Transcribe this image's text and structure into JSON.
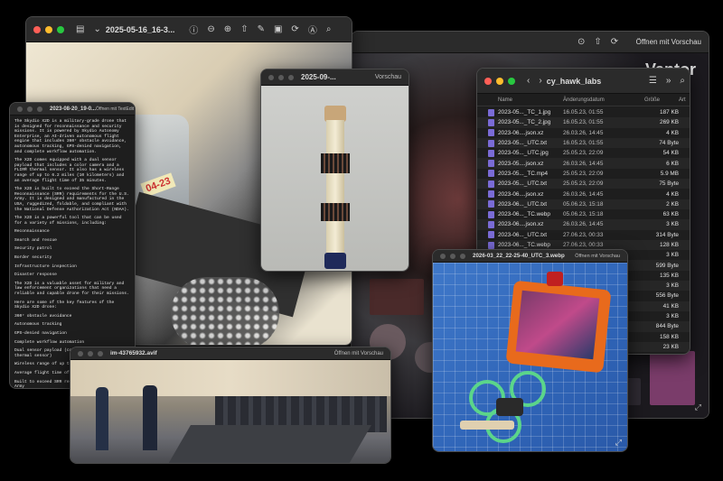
{
  "preview_back": {
    "title": "",
    "open_with": "Öffnen mit Vorschau",
    "brand": "Vantor"
  },
  "preview_foam": {
    "title": "2025-05-16_16-3...",
    "label_on_jar": "04-23"
  },
  "preview_stick": {
    "title": "2025-09-...",
    "app": "Vorschau"
  },
  "textedit": {
    "title": "2023-08-20_19-0...",
    "open_with": "Öffnen mit TextEdit",
    "paragraphs": [
      "The Skydio X2D is a military-grade drone that is designed for reconnaissance and security missions. It is powered by Skydio Autonomy Enterprise, an AI-driven autonomous flight engine that includes 360° obstacle avoidance, autonomous tracking, GPS-denied navigation, and complete workflow automation.",
      "The X2D comes equipped with a dual sensor payload that includes a color camera and a FLIR® thermal sensor. It also has a wireless range of up to 6.2 miles (10 kilometers) and an average flight time of 35 minutes.",
      "The X2D is built to exceed the Short-Range Reconnaissance (SRR) requirements for the U.S. Army. It is designed and manufactured in the USA, ruggedized, foldable, and compliant with the National Defense Authorization Act (NDAA).",
      "The X2D is a powerful tool that can be used for a variety of missions, including:",
      "Reconnaissance",
      "Search and rescue",
      "Security patrol",
      "Border security",
      "Infrastructure inspection",
      "Disaster response",
      "The X2D is a valuable asset for military and law enforcement organizations that need a reliable and capable drone for their missions.",
      "Here are some of the key features of the Skydio X2D drone:",
      "360° obstacle avoidance",
      "Autonomous tracking",
      "GPS-denied navigation",
      "Complete workflow automation",
      "Dual sensor payload (color camera + FLIR thermal sensor)",
      "Wireless range of up to 6.2 miles",
      "Average flight time of 35 minutes",
      "Built to exceed SRR requirements for the U.S. Army",
      "Ruggedized, foldable, and NDAA compliant"
    ]
  },
  "finder": {
    "title": "cy_hawk_labs",
    "columns": {
      "name": "Name",
      "date": "Änderungsdatum",
      "size": "Größe",
      "kind": "Art"
    },
    "rows": [
      {
        "name": "2023-05..._TC_1.jpg",
        "date": "16.05.23, 01:55",
        "size": "187 KB"
      },
      {
        "name": "2023-05..._TC_2.jpg",
        "date": "16.05.23, 01:55",
        "size": "269 KB"
      },
      {
        "name": "2023-06....json.xz",
        "date": "26.03.26, 14:45",
        "size": "4 KB"
      },
      {
        "name": "2023-05..._UTC.txt",
        "date": "16.05.23, 01:55",
        "size": "74 Byte"
      },
      {
        "name": "2023-05..._UTC.jpg",
        "date": "25.05.23, 22:09",
        "size": "54 KB"
      },
      {
        "name": "2023-05....json.xz",
        "date": "26.03.26, 14:45",
        "size": "6 KB"
      },
      {
        "name": "2023-05..._TC.mp4",
        "date": "25.05.23, 22:09",
        "size": "5.9 MB"
      },
      {
        "name": "2023-05..._UTC.txt",
        "date": "25.05.23, 22:09",
        "size": "75 Byte"
      },
      {
        "name": "2023-06....json.xz",
        "date": "26.03.26, 14:45",
        "size": "4 KB"
      },
      {
        "name": "2023-06..._UTC.txt",
        "date": "05.06.23, 15:18",
        "size": "2 KB"
      },
      {
        "name": "2023-06..._TC.webp",
        "date": "05.06.23, 15:18",
        "size": "63 KB"
      },
      {
        "name": "2023-06....json.xz",
        "date": "26.03.26, 14:45",
        "size": "3 KB"
      },
      {
        "name": "2023-06..._UTC.txt",
        "date": "27.06.23, 00:33",
        "size": "314 Byte"
      },
      {
        "name": "2023-06..._TC.webp",
        "date": "27.06.23, 00:33",
        "size": "128 KB"
      },
      {
        "name": "2023-06....json.xz",
        "date": "26.03.26, 14:45",
        "size": "3 KB"
      },
      {
        "name": "2023-06..._UTC.txt",
        "date": "",
        "size": "599 Byte"
      },
      {
        "name": "",
        "date": "",
        "size": "135 KB"
      },
      {
        "name": "",
        "date": "",
        "size": "3 KB"
      },
      {
        "name": "",
        "date": "",
        "size": "556 Byte"
      },
      {
        "name": "",
        "date": "",
        "size": "41 KB"
      },
      {
        "name": "",
        "date": "",
        "size": "3 KB"
      },
      {
        "name": "",
        "date": "",
        "size": "844 Byte"
      },
      {
        "name": "",
        "date": "",
        "size": "158 KB"
      },
      {
        "name": "",
        "date": "",
        "size": "23 KB"
      },
      {
        "name": "",
        "date": "",
        "size": "2 KB"
      },
      {
        "name": "",
        "date": "",
        "size": "740 Byte"
      },
      {
        "name": "",
        "date": "",
        "size": "509 Byte"
      },
      {
        "name": "",
        "date": "",
        "size": "61 KB"
      }
    ]
  },
  "event": {
    "title": "im-43765932.avif",
    "open_with": "Öffnen mit Vorschau"
  },
  "drone": {
    "title": "2026-03_22_22-25-40_UTC_3.webp",
    "open_with": "Öffnen mit Vorschau"
  }
}
